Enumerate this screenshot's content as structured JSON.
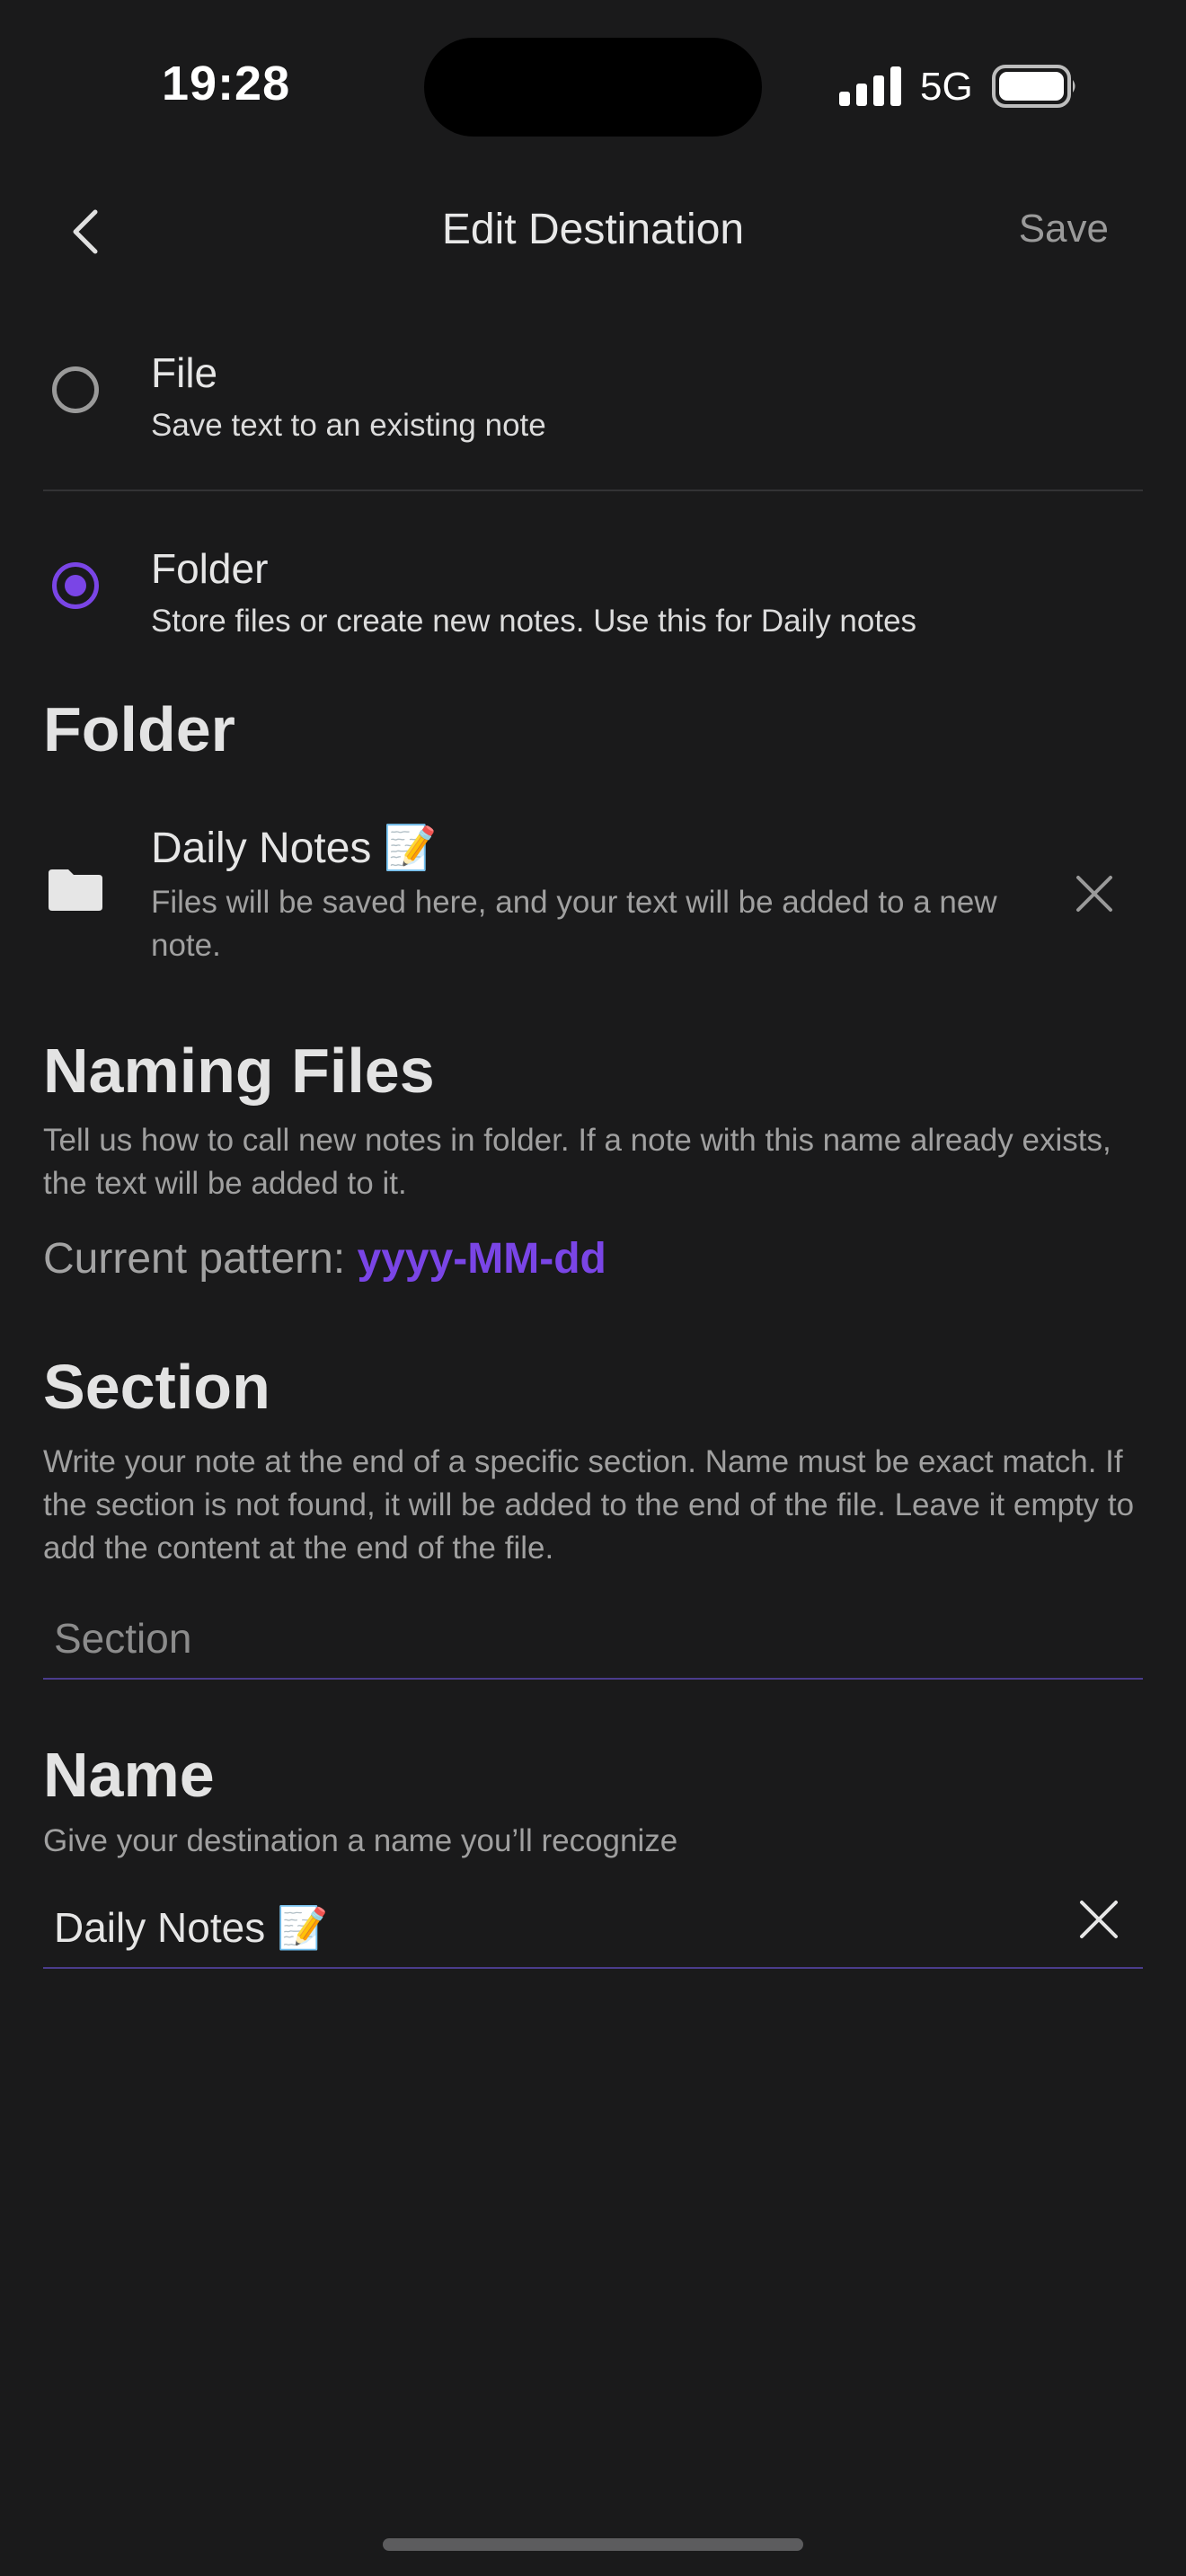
{
  "status_bar": {
    "time": "19:28",
    "network": "5G",
    "icons": [
      "signal-icon",
      "battery-icon"
    ]
  },
  "nav": {
    "title": "Edit Destination",
    "save_label": "Save",
    "back_icon": "chevron-left-icon"
  },
  "options": [
    {
      "title": "File",
      "subtitle": "Save text to an existing note",
      "selected": false
    },
    {
      "title": "Folder",
      "subtitle": "Store files or create new notes. Use this for Daily notes",
      "selected": true
    }
  ],
  "folder_section": {
    "heading": "Folder",
    "folder_name": "Daily Notes 📝",
    "folder_description": "Files will be saved here, and your text will be added to a new note."
  },
  "naming_section": {
    "heading": "Naming Files",
    "description": "Tell us how to call new notes in folder. If a note with this name already exists, the text will be added to it.",
    "pattern_label": "Current pattern: ",
    "pattern_value": "yyyy-MM-dd"
  },
  "section_section": {
    "heading": "Section",
    "description": "Write your note at the end of a specific section. Name must be exact match. If the section is not found, it will be added to the end of the file. Leave it empty to add the content at the end of the file.",
    "input_value": "",
    "input_placeholder": "Section"
  },
  "name_section": {
    "heading": "Name",
    "description": "Give your destination a name you’ll recognize",
    "input_value": "Daily Notes 📝"
  },
  "colors": {
    "background": "#1a1a1b",
    "accent": "#7a45e6",
    "muted_text": "#a0a0a0"
  }
}
